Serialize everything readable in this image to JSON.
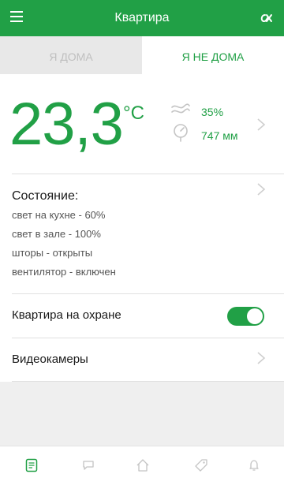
{
  "header": {
    "title": "Квартира",
    "menu_icon": "hamburger-icon",
    "logo_icon": "brand-logo-icon"
  },
  "tabs": [
    {
      "label": "Я ДОМА",
      "active": false
    },
    {
      "label": "Я НЕ ДОМА",
      "active": true
    }
  ],
  "climate": {
    "temperature": "23,3",
    "unit": "°C",
    "humidity": "35%",
    "pressure": "747 мм"
  },
  "status": {
    "title": "Состояние:",
    "lines": [
      "свет на кухне - 60%",
      "свет в зале - 100%",
      "шторы - открыты",
      "вентилятор  - включен"
    ]
  },
  "security": {
    "label": "Квартира на охране",
    "enabled": true
  },
  "cameras": {
    "label": "Видеокамеры"
  },
  "bottom_nav": [
    {
      "icon": "document-icon",
      "active": true
    },
    {
      "icon": "chat-icon",
      "active": false
    },
    {
      "icon": "home-icon",
      "active": false
    },
    {
      "icon": "tag-icon",
      "active": false
    },
    {
      "icon": "bell-icon",
      "active": false
    }
  ],
  "colors": {
    "accent": "#21a046",
    "inactive_icon": "#c4c4c4",
    "background": "#efefef"
  }
}
